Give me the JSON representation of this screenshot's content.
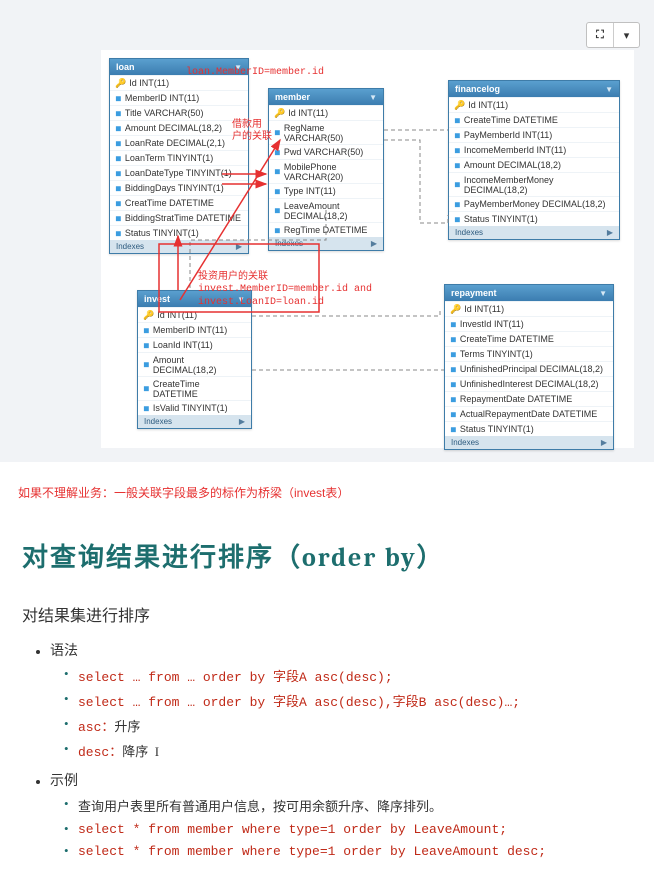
{
  "toolbar": {
    "img_icon": "⛶",
    "dropdown": "▾"
  },
  "entity_labels": {
    "indexes": "Indexes"
  },
  "entities": {
    "loan": {
      "title": "loan",
      "cols": [
        {
          "k": "pk",
          "t": "Id INT(11)"
        },
        {
          "k": "c",
          "t": "MemberID INT(11)"
        },
        {
          "k": "c",
          "t": "Title VARCHAR(50)"
        },
        {
          "k": "c",
          "t": "Amount DECIMAL(18,2)"
        },
        {
          "k": "c",
          "t": "LoanRate DECIMAL(2,1)"
        },
        {
          "k": "c",
          "t": "LoanTerm TINYINT(1)"
        },
        {
          "k": "c",
          "t": "LoanDateType TINYINT(1)"
        },
        {
          "k": "c",
          "t": "BiddingDays TINYINT(1)"
        },
        {
          "k": "c",
          "t": "CreatTime DATETIME"
        },
        {
          "k": "c",
          "t": "BiddingStratTime DATETIME"
        },
        {
          "k": "c",
          "t": "Status TINYINT(1)"
        }
      ]
    },
    "member": {
      "title": "member",
      "cols": [
        {
          "k": "pk",
          "t": "Id INT(11)"
        },
        {
          "k": "c",
          "t": "RegName VARCHAR(50)"
        },
        {
          "k": "c",
          "t": "Pwd VARCHAR(50)"
        },
        {
          "k": "c",
          "t": "MobilePhone VARCHAR(20)"
        },
        {
          "k": "c",
          "t": "Type INT(11)"
        },
        {
          "k": "c",
          "t": "LeaveAmount DECIMAL(18,2)"
        },
        {
          "k": "c",
          "t": "RegTime DATETIME"
        }
      ]
    },
    "financelog": {
      "title": "financelog",
      "cols": [
        {
          "k": "pk",
          "t": "Id INT(11)"
        },
        {
          "k": "c",
          "t": "CreateTime DATETIME"
        },
        {
          "k": "c",
          "t": "PayMemberId INT(11)"
        },
        {
          "k": "c",
          "t": "IncomeMemberId INT(11)"
        },
        {
          "k": "c",
          "t": "Amount DECIMAL(18,2)"
        },
        {
          "k": "c",
          "t": "IncomeMemberMoney DECIMAL(18,2)"
        },
        {
          "k": "c",
          "t": "PayMemberMoney DECIMAL(18,2)"
        },
        {
          "k": "c",
          "t": "Status TINYINT(1)"
        }
      ]
    },
    "invest": {
      "title": "invest",
      "cols": [
        {
          "k": "pk",
          "t": "Id INT(11)"
        },
        {
          "k": "c",
          "t": "MemberID INT(11)"
        },
        {
          "k": "c",
          "t": "LoanId INT(11)"
        },
        {
          "k": "c",
          "t": "Amount DECIMAL(18,2)"
        },
        {
          "k": "c",
          "t": "CreateTime DATETIME"
        },
        {
          "k": "c",
          "t": "IsValid TINYINT(1)"
        }
      ]
    },
    "repayment": {
      "title": "repayment",
      "cols": [
        {
          "k": "pk",
          "t": "Id INT(11)"
        },
        {
          "k": "c",
          "t": "InvestId INT(11)"
        },
        {
          "k": "c",
          "t": "CreateTime DATETIME"
        },
        {
          "k": "c",
          "t": "Terms TINYINT(1)"
        },
        {
          "k": "c",
          "t": "UnfinishedPrincipal DECIMAL(18,2)"
        },
        {
          "k": "c",
          "t": "UnfinishedInterest DECIMAL(18,2)"
        },
        {
          "k": "c",
          "t": "RepaymentDate DATETIME"
        },
        {
          "k": "c",
          "t": "ActualRepaymentDate DATETIME"
        },
        {
          "k": "c",
          "t": "Status TINYINT(1)"
        }
      ]
    }
  },
  "annotations": {
    "a1": "loan.MemberID=member.id",
    "a2_l1": "借款用",
    "a2_l2": "户的关联",
    "a3_l1": "投资用户的关联",
    "a3_l2": "invest.MemberID=member.id and",
    "a3_l3": "invest.LoanID=loan.id"
  },
  "note_below": "如果不理解业务：一般关联字段最多的标作为桥梁（invest表）",
  "tutorial": {
    "title_cn": "对查询结果进行排序（",
    "title_en": "order by",
    "title_close": "）",
    "sub": "对结果集进行排序",
    "li_syntax": "语法",
    "syn1": "select … from … order by 字段A asc(desc);",
    "syn2": "select … from … order by 字段A asc(desc),字段B asc(desc)…;",
    "syn3_a": "asc：",
    "syn3_b": "升序",
    "syn4_a": "desc：",
    "syn4_b": "降序",
    "li_example": "示例",
    "ex1": "查询用户表里所有普通用户信息，按可用余额升序、降序排列。",
    "ex2": "select * from member where type=1 order by LeaveAmount;",
    "ex3": "select * from member where type=1 order by LeaveAmount desc;"
  }
}
